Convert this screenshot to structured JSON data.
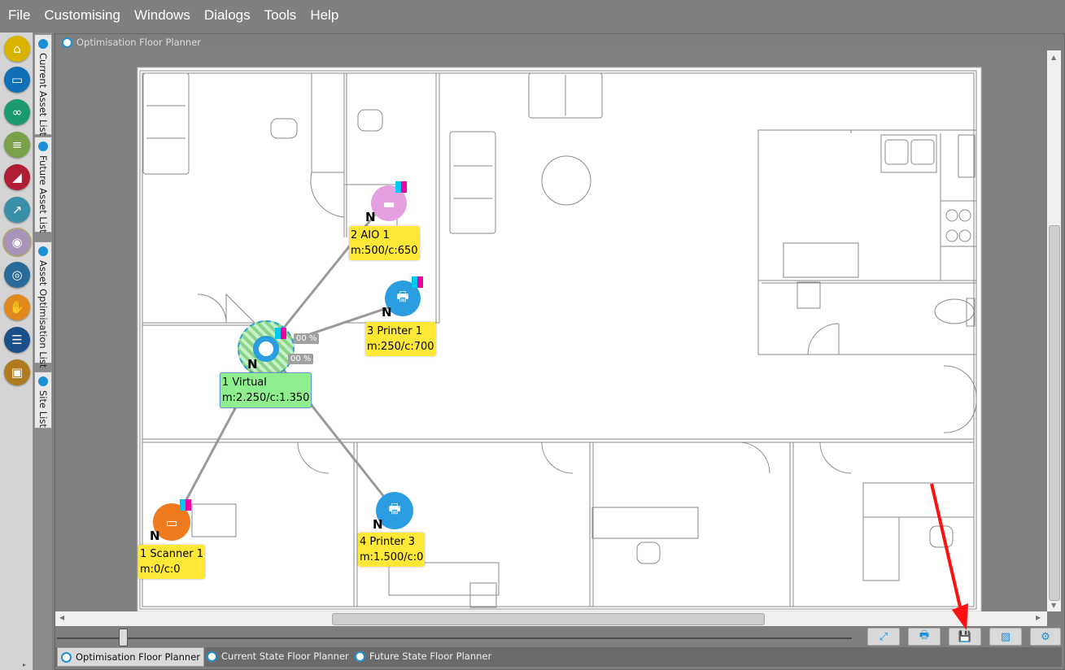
{
  "menu": [
    "File",
    "Customising",
    "Windows",
    "Dialogs",
    "Tools",
    "Help"
  ],
  "toolbar_icons": [
    {
      "name": "home-icon",
      "color": "#d8b400",
      "glyph": "⌂"
    },
    {
      "name": "folder-icon",
      "color": "#1070b5",
      "glyph": "▭"
    },
    {
      "name": "binoculars-icon",
      "color": "#1b9a6e",
      "glyph": "∞"
    },
    {
      "name": "scroll-icon",
      "color": "#7ba04a",
      "glyph": "≡"
    },
    {
      "name": "area-chart-icon",
      "color": "#b01e36",
      "glyph": "◢"
    },
    {
      "name": "trend-icon",
      "color": "#3a8fa8",
      "glyph": "↗"
    },
    {
      "name": "eye-icon",
      "color": "#a894b8",
      "glyph": "◉"
    },
    {
      "name": "target-icon",
      "color": "#2a6a9a",
      "glyph": "◎"
    },
    {
      "name": "handshake-icon",
      "color": "#e08a1e",
      "glyph": "✋"
    },
    {
      "name": "document-list-icon",
      "color": "#1a4f8a",
      "glyph": "☰"
    },
    {
      "name": "briefcase-icon",
      "color": "#b07b1e",
      "glyph": "▣"
    }
  ],
  "side_tabs": [
    "Current Asset List",
    "Future Asset List",
    "Asset Optimisation List",
    "Site List"
  ],
  "panel_title": "Optimisation Floor Planner",
  "devices": [
    {
      "id": "aio",
      "line1": "2 AIO 1",
      "line2": "m:500/c:650",
      "color": "#e4a0e0"
    },
    {
      "id": "printer1",
      "line1": "3 Printer 1",
      "line2": "m:250/c:700",
      "color": "#2a9ee0"
    },
    {
      "id": "virtual",
      "line1": "1 Virtual",
      "line2": "m:2.250/c:1.350",
      "color": "#2a9ee0"
    },
    {
      "id": "scanner",
      "line1": "1 Scanner 1",
      "line2": "m:0/c:0",
      "color": "#f07a1e"
    },
    {
      "id": "printer3",
      "line1": "4 Printer 3",
      "line2": "m:1.500/c:0",
      "color": "#2a9ee0"
    }
  ],
  "node_marker": "N",
  "pct_labels": [
    "00 %",
    "00 %"
  ],
  "bottom_tabs": [
    "Optimisation Floor Planner",
    "Current State Floor Planner",
    "Future State Floor Planner"
  ],
  "action_buttons": [
    "expand-icon",
    "print-icon",
    "save-icon",
    "image-icon",
    "gear-icon"
  ]
}
